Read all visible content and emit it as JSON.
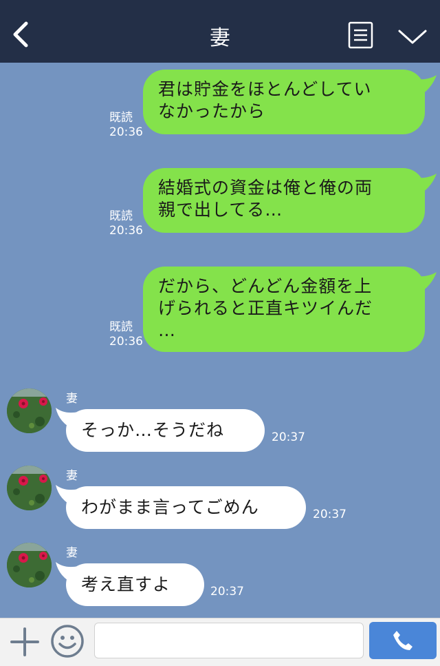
{
  "header": {
    "title": "妻",
    "back_icon": "chevron-left-icon",
    "menu_icon": "menu-list-icon",
    "collapse_icon": "chevron-down-icon",
    "background": "#232f47"
  },
  "chat": {
    "background": "#7494c0",
    "outgoing_color": "#84e24b",
    "outgoing": [
      {
        "lines": [
          "君は貯金をほとんどしてい",
          "なかったから"
        ],
        "read": "既読",
        "time": "20:36"
      },
      {
        "lines": [
          "結婚式の資金は俺と俺の両",
          "親で出してる…"
        ],
        "read": "既読",
        "time": "20:36"
      },
      {
        "lines": [
          "だから、どんどん金額を上",
          "げられると正直キツイんだ",
          "…"
        ],
        "read": "既読",
        "time": "20:36"
      }
    ],
    "incoming": [
      {
        "sender": "妻",
        "text": "そっか…そうだね",
        "time": "20:37"
      },
      {
        "sender": "妻",
        "text": "わがまま言ってごめん",
        "time": "20:37"
      },
      {
        "sender": "妻",
        "text": "考え直すよ",
        "time": "20:37"
      }
    ]
  },
  "input_bar": {
    "plus_icon": "plus-icon",
    "emoji_icon": "smiley-icon",
    "message_placeholder": "",
    "call_icon": "phone-icon",
    "call_color": "#4a86d8"
  }
}
